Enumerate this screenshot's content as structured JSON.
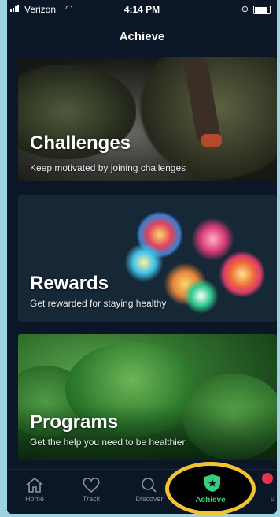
{
  "status": {
    "carrier": "Verizon",
    "time": "4:14 PM"
  },
  "nav": {
    "title": "Achieve"
  },
  "cards": [
    {
      "title": "Challenges",
      "subtitle": "Keep motivated by joining challenges"
    },
    {
      "title": "Rewards",
      "subtitle": "Get rewarded for staying healthy"
    },
    {
      "title": "Programs",
      "subtitle": "Get the help you need to be healthier"
    }
  ],
  "tabs": {
    "home": "Home",
    "track": "Track",
    "discover": "Discover",
    "achieve": "Achieve",
    "you": "u"
  },
  "colors": {
    "accent": "#35d07f",
    "highlight": "#f1c232",
    "background": "#0b1626",
    "badge": "#e3344b"
  },
  "icons": {
    "home": "home-icon",
    "track": "heart-icon",
    "discover": "search-icon",
    "achieve": "shield-star-icon"
  }
}
